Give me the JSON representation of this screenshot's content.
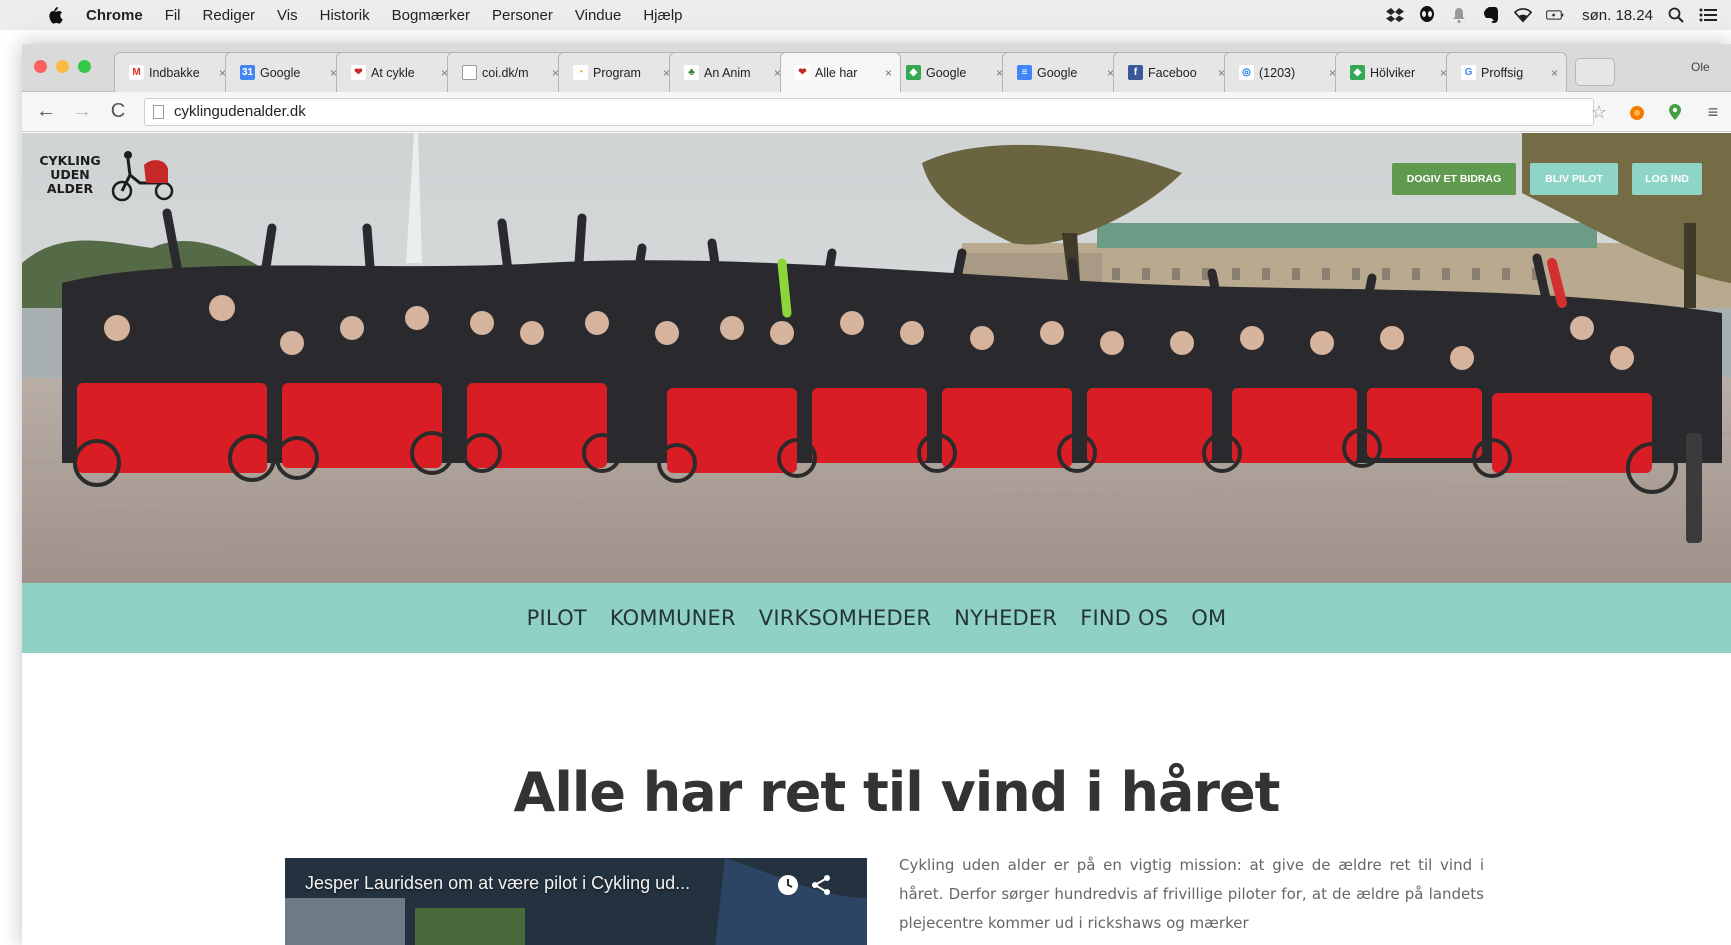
{
  "menubar": {
    "app_name": "Chrome",
    "items": [
      "Fil",
      "Rediger",
      "Vis",
      "Historik",
      "Bogmærker",
      "Personer",
      "Vindue",
      "Hjælp"
    ],
    "clock": "søn. 18.24"
  },
  "tabs": [
    {
      "label": "Indbakke",
      "favicon": "gmail-icon",
      "color": "#ffffff",
      "glyph": "M",
      "glyph_color": "#d93025"
    },
    {
      "label": "Google",
      "favicon": "google-calendar-icon",
      "color": "#4285f4",
      "glyph": "31",
      "glyph_color": "#ffffff"
    },
    {
      "label": "At cykle",
      "favicon": "cycling-logo-icon",
      "color": "#ffffff",
      "glyph": "❤",
      "glyph_color": "#c62828"
    },
    {
      "label": "coi.dk/m",
      "favicon": "blank-page-icon",
      "color": "#ffffff",
      "glyph": "",
      "glyph_color": "#999999"
    },
    {
      "label": "Program",
      "favicon": "program-icon",
      "color": "#ffffff",
      "glyph": "◔",
      "glyph_color": "#f29900"
    },
    {
      "label": "An Anim",
      "favicon": "animation-icon",
      "color": "#ffffff",
      "glyph": "♣",
      "glyph_color": "#2e7d32"
    },
    {
      "label": "Alle har",
      "favicon": "cycling-logo-icon",
      "color": "#ffffff",
      "glyph": "❤",
      "glyph_color": "#c62828",
      "active": true
    },
    {
      "label": "Google",
      "favicon": "google-maps-icon",
      "color": "#34a853",
      "glyph": "◆",
      "glyph_color": "#ffffff"
    },
    {
      "label": "Google",
      "favicon": "google-docs-icon",
      "color": "#4285f4",
      "glyph": "≡",
      "glyph_color": "#ffffff"
    },
    {
      "label": "Faceboo",
      "favicon": "facebook-icon",
      "color": "#3b5998",
      "glyph": "f",
      "glyph_color": "#ffffff"
    },
    {
      "label": "(1203)",
      "favicon": "notification-icon",
      "color": "#ffffff",
      "glyph": "◎",
      "glyph_color": "#1a73e8"
    },
    {
      "label": "Hölviker",
      "favicon": "map-icon",
      "color": "#34a853",
      "glyph": "◆",
      "glyph_color": "#ffffff"
    },
    {
      "label": "Proffsig",
      "favicon": "google-icon",
      "color": "#ffffff",
      "glyph": "G",
      "glyph_color": "#4285f4"
    }
  ],
  "profile_label": "Ole",
  "address_bar": {
    "url": "cyklingudenalder.dk"
  },
  "site": {
    "logo_lines": [
      "CYKLING",
      "UDEN",
      "ALDER"
    ],
    "cta": {
      "give": "DOGIV ET BIDRAG",
      "pilot": "BLIV PILOT",
      "login": "LOG IND"
    },
    "nav": [
      "PILOT",
      "KOMMUNER",
      "VIRKSOMHEDER",
      "NYHEDER",
      "FIND OS",
      "OM"
    ],
    "headline": "Alle har ret til vind i håret",
    "video_title": "Jesper Lauridsen om at være pilot i Cykling ud...",
    "intro": "Cykling uden alder er på en vigtig mission: at give de ældre ret til vind i håret. Derfor sørger hundredvis af frivillige piloter for, at de ældre på landets plejecentre kommer ud i rickshaws og mærker"
  },
  "colors": {
    "nav_band": "#8fd1c3",
    "give_button": "#5f9a4f",
    "pilot_button": "#8fd5c7",
    "rickshaw_red": "#d81e24"
  }
}
